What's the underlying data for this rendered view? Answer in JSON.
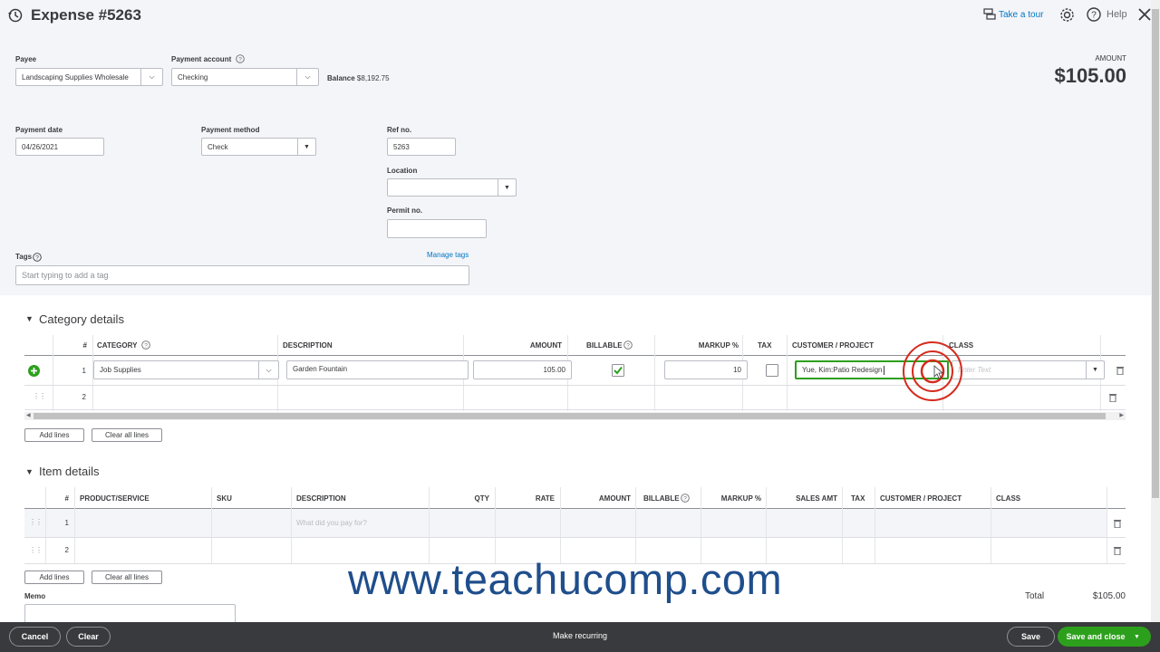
{
  "header": {
    "title": "Expense #5263",
    "take_tour": "Take a tour",
    "help": "Help"
  },
  "payee": {
    "label": "Payee",
    "value": "Landscaping Supplies Wholesale"
  },
  "payment_account": {
    "label": "Payment account",
    "value": "Checking"
  },
  "balance": {
    "label": "Balance",
    "value": "$8,192.75"
  },
  "amount": {
    "label": "AMOUNT",
    "value": "$105.00"
  },
  "payment_date": {
    "label": "Payment date",
    "value": "04/26/2021"
  },
  "payment_method": {
    "label": "Payment method",
    "value": "Check"
  },
  "ref_no": {
    "label": "Ref no.",
    "value": "5263"
  },
  "location": {
    "label": "Location",
    "value": ""
  },
  "permit_no": {
    "label": "Permit no.",
    "value": ""
  },
  "tags": {
    "label": "Tags",
    "manage": "Manage tags",
    "placeholder": "Start typing to add a tag"
  },
  "category_details": {
    "title": "Category details",
    "columns": [
      "#",
      "CATEGORY",
      "DESCRIPTION",
      "AMOUNT",
      "BILLABLE",
      "MARKUP %",
      "TAX",
      "CUSTOMER / PROJECT",
      "CLASS"
    ],
    "rows": [
      {
        "num": "1",
        "category": "Job Supplies",
        "description": "Garden Fountain",
        "amount": "105.00",
        "markup": "10",
        "customer": "Yue, Kim:Patio Redesign",
        "class_placeholder": "Enter Text"
      },
      {
        "num": "2"
      }
    ],
    "add_lines": "Add lines",
    "clear_lines": "Clear all lines"
  },
  "item_details": {
    "title": "Item details",
    "columns": [
      "#",
      "PRODUCT/SERVICE",
      "SKU",
      "DESCRIPTION",
      "QTY",
      "RATE",
      "AMOUNT",
      "BILLABLE",
      "MARKUP %",
      "SALES AMT",
      "TAX",
      "CUSTOMER / PROJECT",
      "CLASS"
    ],
    "rows": [
      {
        "num": "1",
        "description_placeholder": "What did you pay for?"
      },
      {
        "num": "2"
      }
    ],
    "add_lines": "Add lines",
    "clear_lines": "Clear all lines"
  },
  "memo": {
    "label": "Memo"
  },
  "total": {
    "label": "Total",
    "value": "$105.00"
  },
  "watermark": "www.teachucomp.com",
  "footer": {
    "cancel": "Cancel",
    "clear": "Clear",
    "make_recurring": "Make recurring",
    "save": "Save",
    "save_close": "Save and close"
  },
  "colors": {
    "accent_green": "#2ca01c",
    "link_blue": "#0077c5",
    "footer_bg": "#393a3d",
    "cursor_red": "#d52b1e"
  }
}
